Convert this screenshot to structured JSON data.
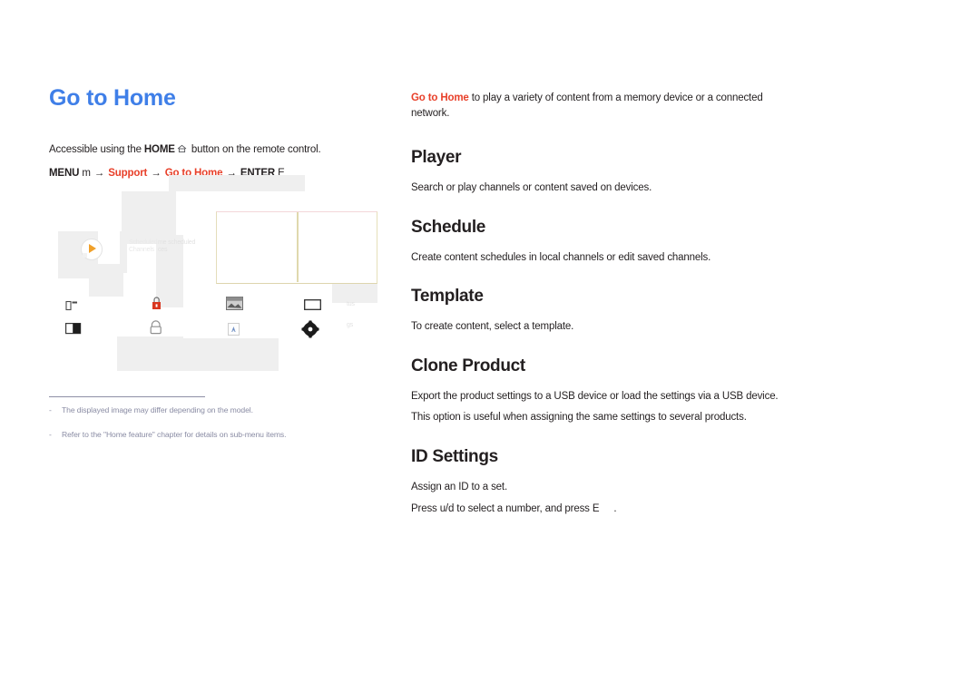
{
  "left": {
    "title": "Go to Home",
    "intro": {
      "prefix": "Accessible using the ",
      "bold": "HOME",
      "home_icon": "home-icon",
      "suffix": " button on the remote control."
    },
    "breadcrumb": {
      "menu_label": "MENU",
      "menu_key": "m",
      "arrow": "→",
      "step1": "Support",
      "step2": "Go to Home",
      "enter_label": "ENTER",
      "enter_key": "E"
    },
    "footnotes": [
      "The displayed image may differ depending on the model.",
      "Refer to the \"Home feature\" chapter for details on sub-menu items."
    ],
    "mock": {
      "ghost_labels": [
        "Scheduled",
        "Channels",
        "me scheduled",
        "ces",
        "tus",
        "gs"
      ],
      "icons": [
        "bracket-corner-icon",
        "lock-red-icon",
        "half-filled-rect-icon",
        "lock-outline-icon",
        "image-thumbnail-icon",
        "rectangle-outline-icon",
        "document-a-icon",
        "gear-icon",
        "play-circle-icon"
      ]
    }
  },
  "right": {
    "lead": {
      "accent": "Go to Home",
      "text": " to play a variety of content from a memory device or a connected network."
    },
    "sections": [
      {
        "heading": "Player",
        "paragraphs": [
          "Search or play channels or content saved on devices."
        ]
      },
      {
        "heading": "Schedule",
        "paragraphs": [
          "Create content schedules in local channels or edit saved channels."
        ]
      },
      {
        "heading": "Template",
        "paragraphs": [
          "To create content, select a template."
        ]
      },
      {
        "heading": "Clone Product",
        "paragraphs": [
          "Export the product settings to a USB device or load the settings via a USB device.",
          "This option is useful when assigning the same settings to several products."
        ]
      },
      {
        "heading": "ID Settings",
        "paragraphs": [
          "Assign an ID to a set.",
          "Press u/d to select a number, and press E"
        ],
        "trailing": "."
      }
    ]
  },
  "colors": {
    "title_blue": "#3f7fe8",
    "accent_red": "#e8402a",
    "footnote_gray": "#8a8ca4",
    "body_text": "#231f20",
    "play_orange": "#f0a02a",
    "lock_red": "#d8361f"
  }
}
